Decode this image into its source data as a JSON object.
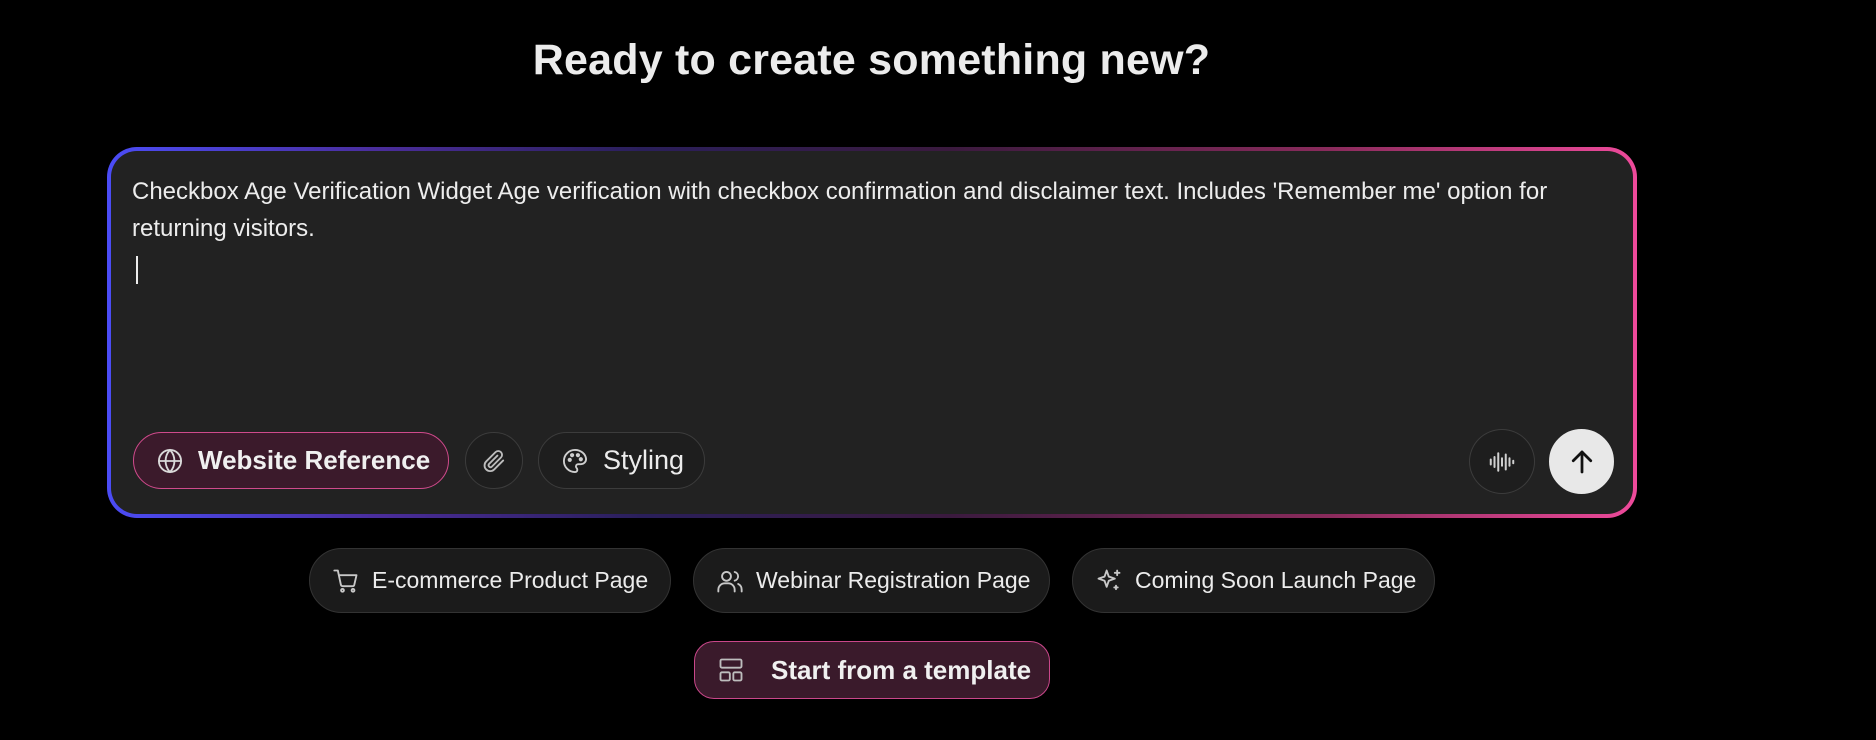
{
  "headline": "Ready to create something new?",
  "prompt": {
    "text": "Checkbox Age Verification Widget Age verification with checkbox confirmation and disclaimer text. Includes 'Remember me' option for returning visitors."
  },
  "toolbar": {
    "website_reference_label": "Website Reference",
    "styling_label": "Styling"
  },
  "suggestions": [
    {
      "label": "E-commerce Product Page",
      "icon": "cart-icon"
    },
    {
      "label": "Webinar Registration Page",
      "icon": "users-icon"
    },
    {
      "label": "Coming Soon Launch Page",
      "icon": "sparkles-icon"
    }
  ],
  "template_button": {
    "label": "Start from a template",
    "icon": "layout-icon"
  },
  "colors": {
    "background": "#000000",
    "panel": "#222222",
    "gradient_start": "#4b4cf6",
    "gradient_end": "#ee4a9b",
    "accent_pink": "#d04a8c"
  }
}
